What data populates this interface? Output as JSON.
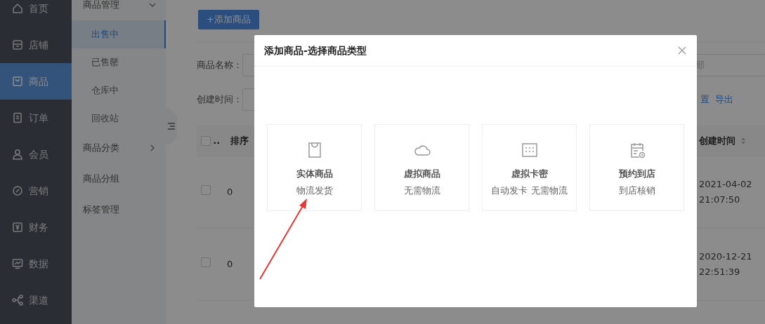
{
  "sidebar": {
    "items": [
      {
        "label": "首页",
        "selected": false
      },
      {
        "label": "店铺",
        "selected": false
      },
      {
        "label": "商品",
        "selected": true
      },
      {
        "label": "订单",
        "selected": false
      },
      {
        "label": "会员",
        "selected": false
      },
      {
        "label": "营销",
        "selected": false
      },
      {
        "label": "财务",
        "selected": false
      },
      {
        "label": "数据",
        "selected": false
      },
      {
        "label": "渠道",
        "selected": false
      }
    ]
  },
  "submenu": {
    "items": [
      {
        "label": "商品管理",
        "kind": "folder",
        "expanded": true,
        "children": [
          {
            "label": "出售中",
            "selected": true
          },
          {
            "label": "已售罄",
            "selected": false
          },
          {
            "label": "仓库中",
            "selected": false
          },
          {
            "label": "回收站",
            "selected": false
          }
        ]
      },
      {
        "label": "商品分类",
        "kind": "folder",
        "expanded": false
      },
      {
        "label": "商品分组",
        "kind": "page"
      },
      {
        "label": "标签管理",
        "kind": "page"
      }
    ]
  },
  "toolbar": {
    "add_button": "+添加商品"
  },
  "filters": [
    {
      "label": "商品名称："
    },
    {
      "label": "创建时间："
    }
  ],
  "status_field": {
    "value": "部"
  },
  "actions": [
    "置",
    "导出"
  ],
  "table": {
    "header_checkbox": {
      "checked": false
    },
    "columns": [
      {
        "label": ".."
      },
      {
        "label": "排序"
      },
      {
        "label": "创建时间",
        "sortable": true
      }
    ],
    "rows": [
      {
        "checked": false,
        "sort": "0",
        "created": "2021-04-02 21:07:50"
      },
      {
        "checked": false,
        "sort": "0",
        "created": "2020-12-21 22:51:39"
      }
    ]
  },
  "modal": {
    "title": "添加商品-选择商品类型",
    "options": [
      {
        "title": "实体商品",
        "subtitle": "物流发货"
      },
      {
        "title": "虚拟商品",
        "subtitle": "无需物流"
      },
      {
        "title": "虚拟卡密",
        "subtitle": "自动发卡 无需物流"
      },
      {
        "title": "预约到店",
        "subtitle": "到店核销"
      }
    ]
  }
}
